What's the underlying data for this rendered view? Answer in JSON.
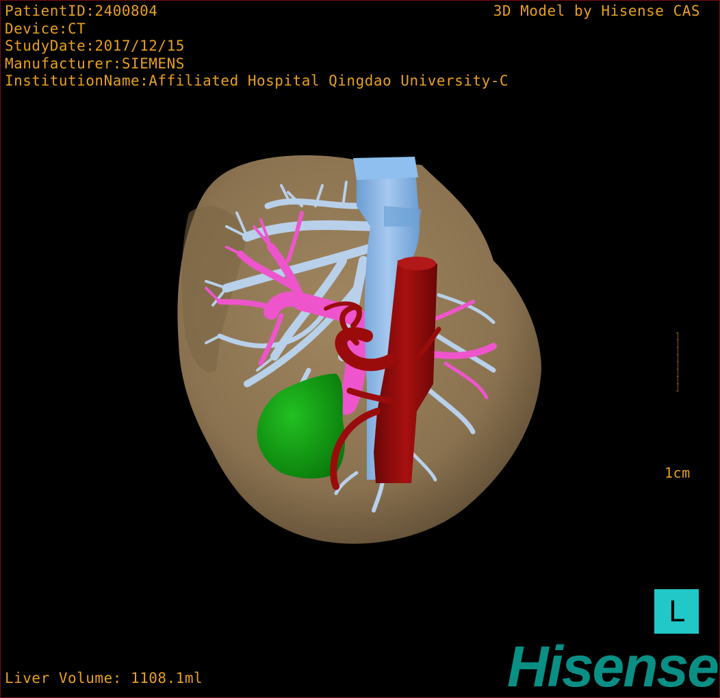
{
  "header": {
    "patient_id": "PatientID:2400804",
    "device": "Device:CT",
    "study_date": "StudyDate:2017/12/15",
    "manufacturer": "Manufacturer:SIEMENS",
    "institution": "InstitutionName:Affiliated Hospital Qingdao University-C"
  },
  "credit": "3D Model by Hisense CAS",
  "scale": {
    "label": "1cm"
  },
  "orientation": "L",
  "footer": {
    "liver_volume": "Liver Volume: 1108.1ml"
  },
  "logo": "Hisense",
  "colors": {
    "text": "#e8a020",
    "liver": "#8e7650",
    "hepatic_vein": "#b8d0ea",
    "portal_vein": "#ee55cc",
    "artery": "#9a0c0c",
    "ivc": "#7fb2e6",
    "tumor": "#12a012",
    "orientation_box": "#22c7c7",
    "logo": "#0a8f85"
  }
}
